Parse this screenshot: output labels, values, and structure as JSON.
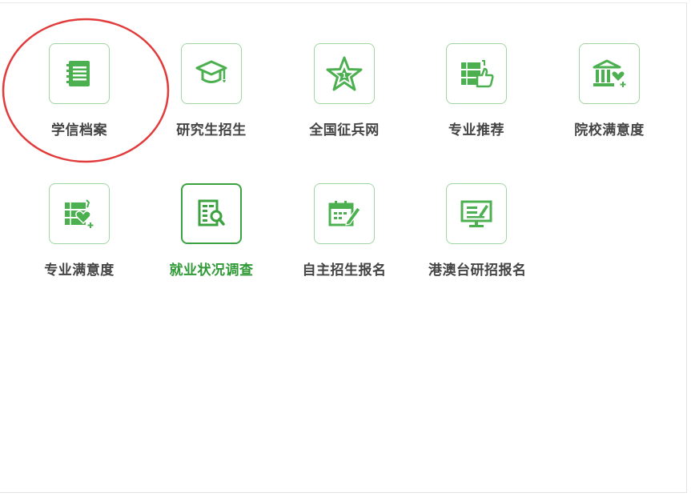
{
  "accent_color": "#4cb050",
  "annotation_color": "#e23b3b",
  "items": [
    {
      "label": "学信档案",
      "icon": "notebook-icon"
    },
    {
      "label": "研究生招生",
      "icon": "graduation-cap-icon"
    },
    {
      "label": "全国征兵网",
      "icon": "star-badge-icon"
    },
    {
      "label": "专业推荐",
      "icon": "books-thumbs-up-icon"
    },
    {
      "label": "院校满意度",
      "icon": "building-heart-icon"
    },
    {
      "label": "专业满意度",
      "icon": "books-heart-icon"
    },
    {
      "label": "就业状况调查",
      "icon": "document-search-icon",
      "active": true
    },
    {
      "label": "自主招生报名",
      "icon": "calendar-edit-icon"
    },
    {
      "label": "港澳台研招报名",
      "icon": "monitor-edit-icon"
    }
  ]
}
